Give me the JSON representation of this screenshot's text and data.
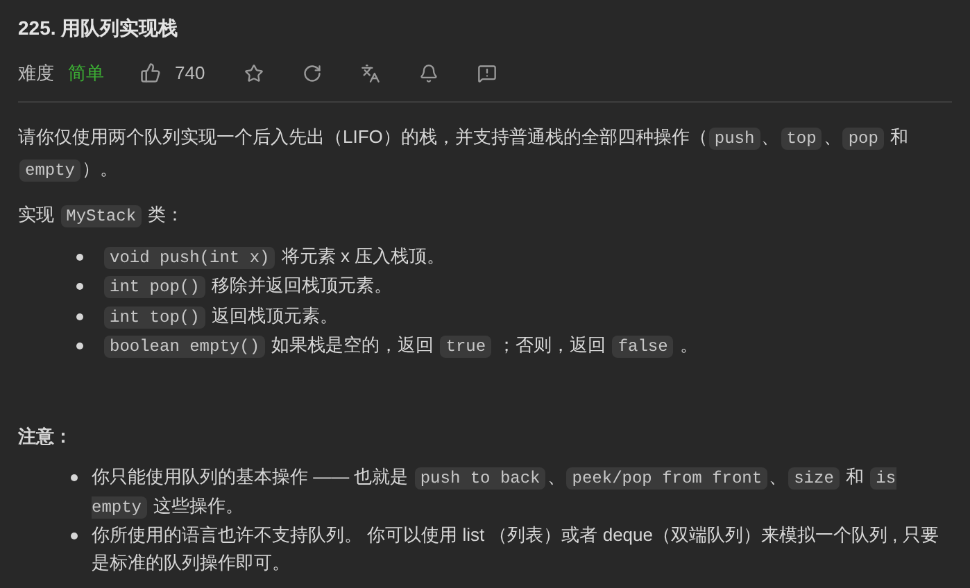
{
  "title": "225. 用队列实现栈",
  "meta": {
    "difficulty_label": "难度",
    "difficulty": "简单",
    "likes": "740"
  },
  "intro": [
    {
      "kind": "text",
      "text": "请你仅使用两个队列实现一个后入先出（LIFO）的栈，并支持普通栈的全部四种操作（"
    },
    {
      "kind": "code",
      "text": "push"
    },
    {
      "kind": "text",
      "text": "、"
    },
    {
      "kind": "code",
      "text": "top"
    },
    {
      "kind": "text",
      "text": "、"
    },
    {
      "kind": "code",
      "text": "pop"
    },
    {
      "kind": "text",
      "text": " 和 "
    },
    {
      "kind": "code",
      "text": "empty"
    },
    {
      "kind": "text",
      "text": "）。"
    }
  ],
  "implement": [
    {
      "kind": "text",
      "text": "实现 "
    },
    {
      "kind": "code",
      "text": "MyStack"
    },
    {
      "kind": "text",
      "text": " 类："
    }
  ],
  "methods": [
    [
      {
        "kind": "code",
        "text": "void push(int x)"
      },
      {
        "kind": "text",
        "text": " 将元素 x 压入栈顶。"
      }
    ],
    [
      {
        "kind": "code",
        "text": "int pop()"
      },
      {
        "kind": "text",
        "text": " 移除并返回栈顶元素。"
      }
    ],
    [
      {
        "kind": "code",
        "text": "int top()"
      },
      {
        "kind": "text",
        "text": " 返回栈顶元素。"
      }
    ],
    [
      {
        "kind": "code",
        "text": "boolean empty()"
      },
      {
        "kind": "text",
        "text": " 如果栈是空的，返回 "
      },
      {
        "kind": "code",
        "text": "true"
      },
      {
        "kind": "text",
        "text": " ；否则，返回 "
      },
      {
        "kind": "code",
        "text": "false"
      },
      {
        "kind": "text",
        "text": " 。"
      }
    ]
  ],
  "note_heading": "注意：",
  "notes": [
    [
      {
        "kind": "text",
        "text": "你只能使用队列的基本操作 —— 也就是 "
      },
      {
        "kind": "code",
        "text": "push to back"
      },
      {
        "kind": "text",
        "text": "、"
      },
      {
        "kind": "code",
        "text": "peek/pop from front"
      },
      {
        "kind": "text",
        "text": "、"
      },
      {
        "kind": "code",
        "text": "size"
      },
      {
        "kind": "text",
        "text": " 和 "
      },
      {
        "kind": "code",
        "text": "is empty"
      },
      {
        "kind": "text",
        "text": " 这些操作。"
      }
    ],
    [
      {
        "kind": "text",
        "text": "你所使用的语言也许不支持队列。 你可以使用 list （列表）或者 deque（双端队列）来模拟一个队列 , 只要是标准的队列操作即可。"
      }
    ]
  ]
}
